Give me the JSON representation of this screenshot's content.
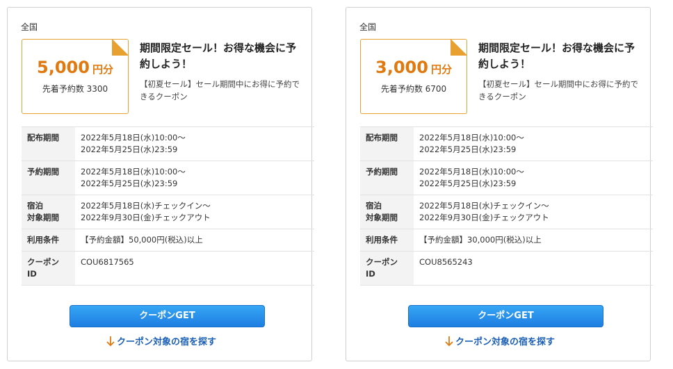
{
  "accent_color": "#e07a10",
  "button_color": "#1e7ee2",
  "link_color": "#1a5fb4",
  "coupons": [
    {
      "region": "全国",
      "amount": "5,000",
      "unit": "円分",
      "limit": "先着予約数 3300",
      "headline": "期間限定セール！お得な機会に予約しよう！",
      "description": "【初夏セール】セール期間中にお得に予約できるクーポン",
      "rows": [
        {
          "label": [
            "配布期間"
          ],
          "value": [
            "2022年5月18日(水)10:00～",
            "2022年5月25日(水)23:59"
          ]
        },
        {
          "label": [
            "予約期間"
          ],
          "value": [
            "2022年5月18日(水)10:00～",
            "2022年5月25日(水)23:59"
          ]
        },
        {
          "label": [
            "宿泊",
            "対象期間"
          ],
          "value": [
            "2022年5月18日(水)チェックイン～",
            "2022年9月30日(金)チェックアウト"
          ]
        },
        {
          "label": [
            "利用条件"
          ],
          "value": [
            "【予約金額】50,000円(税込)以上"
          ]
        },
        {
          "label": [
            "クーポン",
            "ID"
          ],
          "value": [
            "COU6817565"
          ]
        }
      ],
      "button_label": "クーポンGET",
      "link_label": "クーポン対象の宿を探す",
      "arrow_icon": "arrow-down-icon"
    },
    {
      "region": "全国",
      "amount": "3,000",
      "unit": "円分",
      "limit": "先着予約数 6700",
      "headline": "期間限定セール！お得な機会に予約しよう！",
      "description": "【初夏セール】セール期間中にお得に予約できるクーポン",
      "rows": [
        {
          "label": [
            "配布期間"
          ],
          "value": [
            "2022年5月18日(水)10:00～",
            "2022年5月25日(水)23:59"
          ]
        },
        {
          "label": [
            "予約期間"
          ],
          "value": [
            "2022年5月18日(水)10:00～",
            "2022年5月25日(水)23:59"
          ]
        },
        {
          "label": [
            "宿泊",
            "対象期間"
          ],
          "value": [
            "2022年5月18日(水)チェックイン～",
            "2022年9月30日(金)チェックアウト"
          ]
        },
        {
          "label": [
            "利用条件"
          ],
          "value": [
            "【予約金額】30,000円(税込)以上"
          ]
        },
        {
          "label": [
            "クーポン",
            "ID"
          ],
          "value": [
            "COU8565243"
          ]
        }
      ],
      "button_label": "クーポンGET",
      "link_label": "クーポン対象の宿を探す",
      "arrow_icon": "arrow-down-icon"
    }
  ]
}
